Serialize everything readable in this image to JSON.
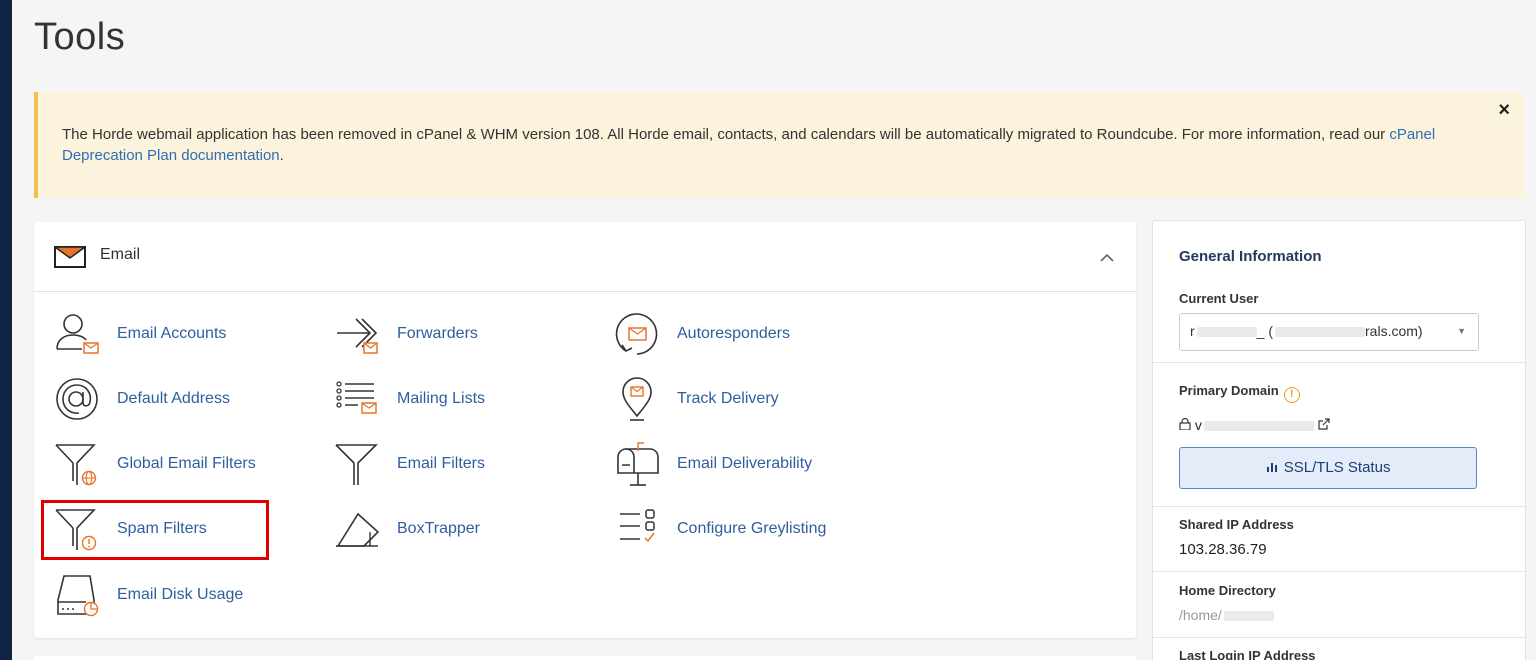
{
  "page": {
    "title": "Tools"
  },
  "notice": {
    "text": "The Horde webmail application has been removed in cPanel & WHM version 108. All Horde email, contacts, and calendars will be automatically migrated to Roundcube. For more information, read our ",
    "link_text": "cPanel Deprecation Plan documentation",
    "text_end": ".",
    "close_glyph": "×"
  },
  "email_section": {
    "title": "Email",
    "tools": [
      {
        "label": "Email Accounts",
        "icon": "user-envelope-icon"
      },
      {
        "label": "Forwarders",
        "icon": "forward-arrow-icon"
      },
      {
        "label": "Autoresponders",
        "icon": "autoresponder-icon"
      },
      {
        "label": "Default Address",
        "icon": "at-sign-icon"
      },
      {
        "label": "Mailing Lists",
        "icon": "mailing-list-icon"
      },
      {
        "label": "Track Delivery",
        "icon": "location-pin-envelope-icon"
      },
      {
        "label": "Global Email Filters",
        "icon": "funnel-globe-icon"
      },
      {
        "label": "Email Filters",
        "icon": "funnel-icon"
      },
      {
        "label": "Email Deliverability",
        "icon": "mailbox-icon"
      },
      {
        "label": "Spam Filters",
        "icon": "funnel-warning-icon"
      },
      {
        "label": "BoxTrapper",
        "icon": "box-trap-icon"
      },
      {
        "label": "Configure Greylisting",
        "icon": "checklist-icon"
      },
      {
        "label": "Email Disk Usage",
        "icon": "disk-usage-icon"
      }
    ]
  },
  "general_info": {
    "title": "General Information",
    "current_user_label": "Current User",
    "current_user_value_start": "r",
    "current_user_value_mid": "_ (",
    "current_user_value_end": "rals.com)",
    "primary_domain_label": "Primary Domain",
    "primary_domain_value": "v",
    "ssl_button": "SSL/TLS Status",
    "shared_ip_label": "Shared IP Address",
    "shared_ip_value": "103.28.36.79",
    "home_dir_label": "Home Directory",
    "home_dir_value": "/home/",
    "last_login_label": "Last Login IP Address"
  },
  "colors": {
    "accent": "#2f5e9e",
    "icon_orange": "#e8742c",
    "warning": "#f0c14b",
    "highlight": "#e00000"
  }
}
